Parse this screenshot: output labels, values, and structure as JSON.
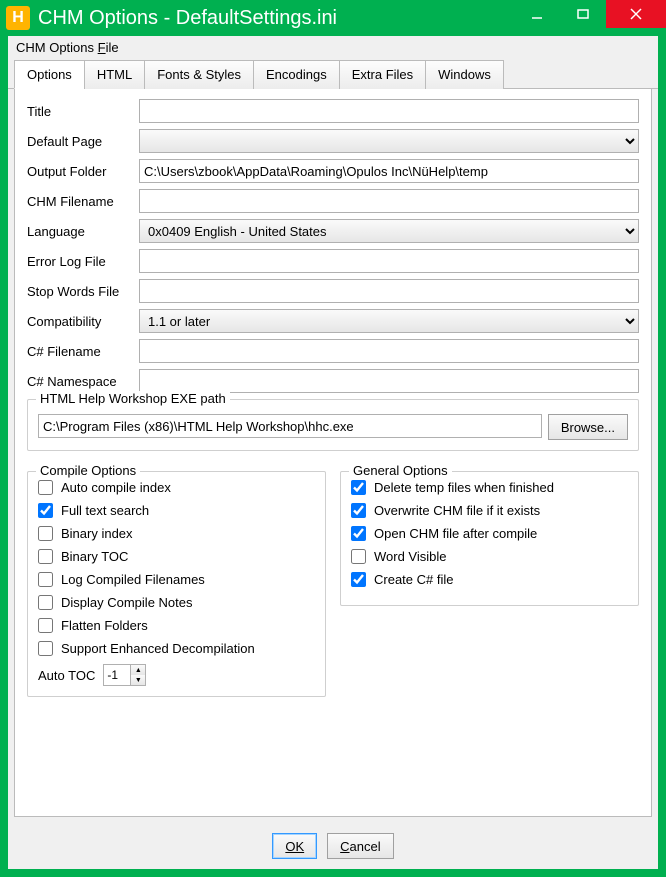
{
  "window": {
    "title": "CHM Options  - DefaultSettings.ini",
    "app_icon_letter": "H"
  },
  "menubar": {
    "file_label": "CHM Options File",
    "file_underline_char": "F"
  },
  "tabs": [
    {
      "label": "Options",
      "active": true
    },
    {
      "label": "HTML",
      "active": false
    },
    {
      "label": "Fonts & Styles",
      "active": false
    },
    {
      "label": "Encodings",
      "active": false
    },
    {
      "label": "Extra Files",
      "active": false
    },
    {
      "label": "Windows",
      "active": false
    }
  ],
  "fields": {
    "title": {
      "label": "Title",
      "value": ""
    },
    "default_page": {
      "label": "Default Page",
      "value": ""
    },
    "output_folder": {
      "label": "Output Folder",
      "value": "C:\\Users\\zbook\\AppData\\Roaming\\Opulos Inc\\NüHelp\\temp"
    },
    "chm_filename": {
      "label": "CHM Filename",
      "value": ""
    },
    "language": {
      "label": "Language",
      "value": "0x0409 English - United States"
    },
    "error_log": {
      "label": "Error Log File",
      "value": ""
    },
    "stop_words": {
      "label": "Stop Words File",
      "value": ""
    },
    "compatibility": {
      "label": "Compatibility",
      "value": "1.1 or later"
    },
    "cs_filename": {
      "label": "C# Filename",
      "value": ""
    },
    "cs_namespace": {
      "label": "C# Namespace",
      "value": ""
    }
  },
  "workshop": {
    "legend": "HTML Help Workshop EXE path",
    "path": "C:\\Program Files (x86)\\HTML Help Workshop\\hhc.exe",
    "browse_label": "Browse..."
  },
  "compile_options": {
    "legend": "Compile Options",
    "items": [
      {
        "label": "Auto compile index",
        "checked": false
      },
      {
        "label": "Full text search",
        "checked": true
      },
      {
        "label": "Binary index",
        "checked": false
      },
      {
        "label": "Binary TOC",
        "checked": false
      },
      {
        "label": "Log Compiled Filenames",
        "checked": false
      },
      {
        "label": "Display Compile Notes",
        "checked": false
      },
      {
        "label": "Flatten Folders",
        "checked": false
      },
      {
        "label": "Support Enhanced Decompilation",
        "checked": false
      }
    ],
    "auto_toc_label": "Auto TOC",
    "auto_toc_value": "-1"
  },
  "general_options": {
    "legend": "General Options",
    "items": [
      {
        "label": "Delete temp files when finished",
        "checked": true
      },
      {
        "label": "Overwrite CHM file if it exists",
        "checked": true
      },
      {
        "label": "Open CHM file after compile",
        "checked": true
      },
      {
        "label": "Word Visible",
        "checked": false
      },
      {
        "label": "Create C# file",
        "checked": true
      }
    ]
  },
  "footer": {
    "ok": "OK",
    "cancel": "Cancel"
  }
}
